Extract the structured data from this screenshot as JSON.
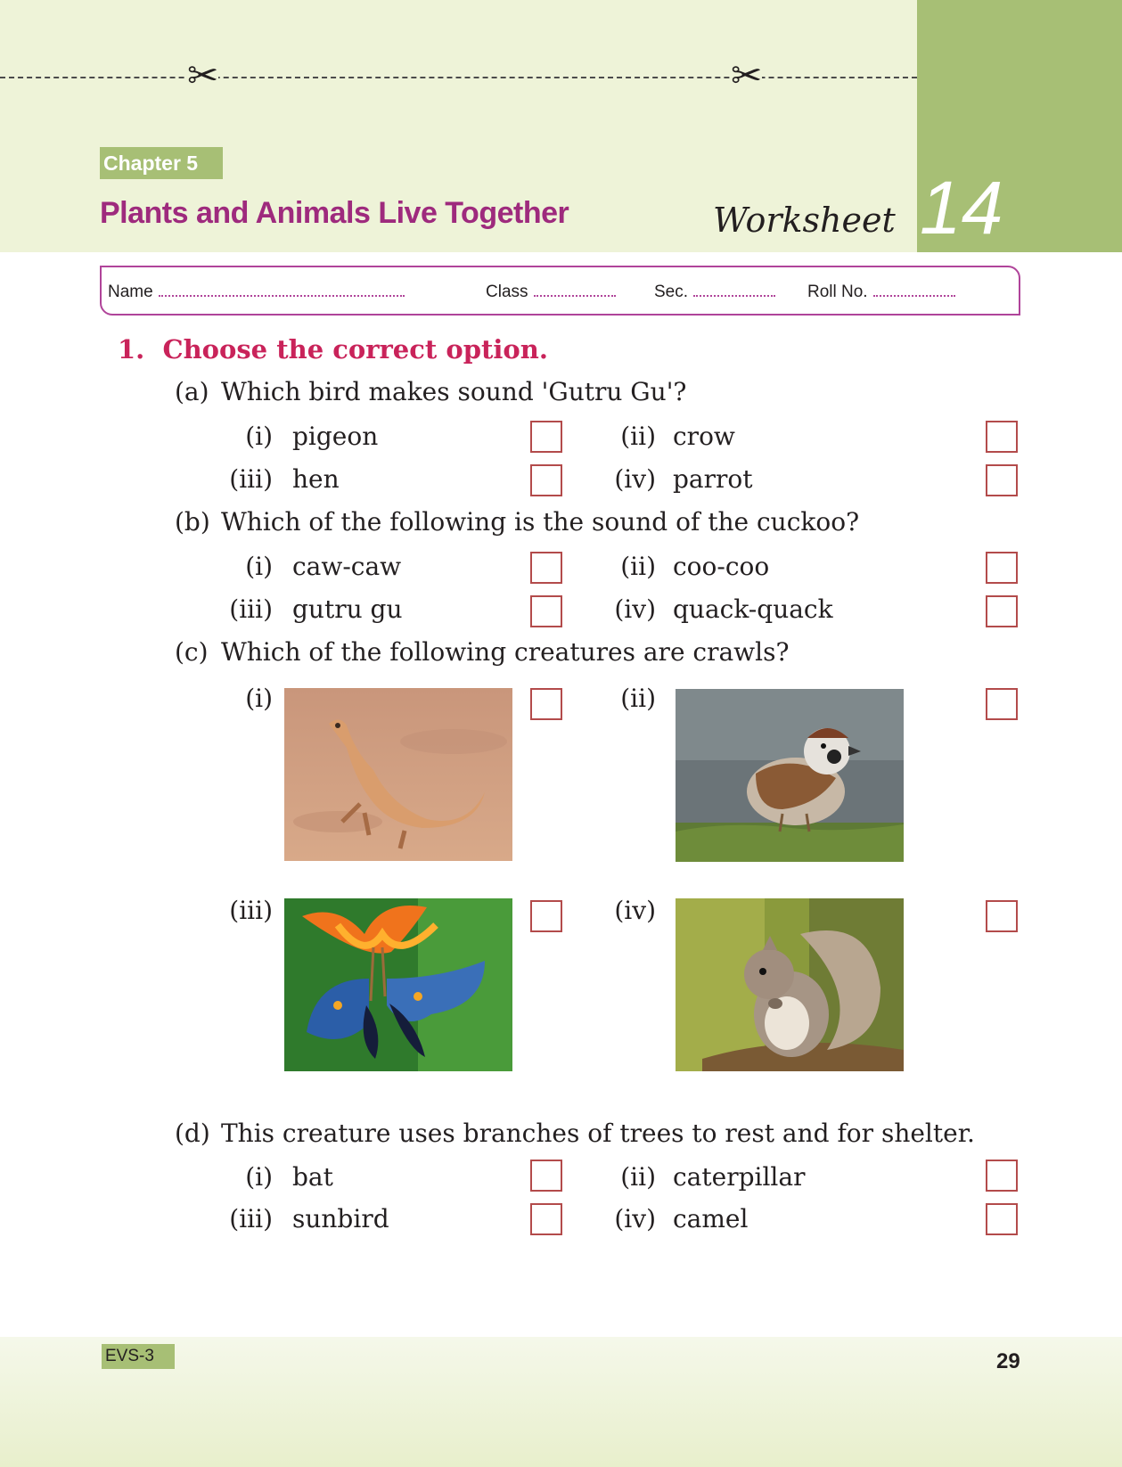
{
  "header": {
    "chapter": "Chapter 5",
    "title": "Plants and Animals Live Together",
    "worksheet_word": "Worksheet",
    "worksheet_number": "14"
  },
  "name_fields": {
    "name": "Name",
    "class": "Class",
    "sec": "Sec.",
    "roll": "Roll No."
  },
  "section": {
    "number": "1.",
    "heading": "Choose the correct option."
  },
  "questions": {
    "a": {
      "label": "(a)",
      "text": "Which bird makes sound 'Gutru Gu'?",
      "options": [
        {
          "num": "(i)",
          "text": "pigeon"
        },
        {
          "num": "(ii)",
          "text": "crow"
        },
        {
          "num": "(iii)",
          "text": "hen"
        },
        {
          "num": "(iv)",
          "text": "parrot"
        }
      ]
    },
    "b": {
      "label": "(b)",
      "text": "Which of the following is the sound of the cuckoo?",
      "options": [
        {
          "num": "(i)",
          "text": "caw-caw"
        },
        {
          "num": "(ii)",
          "text": "coo-coo"
        },
        {
          "num": "(iii)",
          "text": "gutru gu"
        },
        {
          "num": "(iv)",
          "text": "quack-quack"
        }
      ]
    },
    "c": {
      "label": "(c)",
      "text": "Which of the following creatures are crawls?",
      "options": [
        {
          "num": "(i)",
          "image": "lizard"
        },
        {
          "num": "(ii)",
          "image": "sparrow"
        },
        {
          "num": "(iii)",
          "image": "butterflies-on-lily"
        },
        {
          "num": "(iv)",
          "image": "squirrel"
        }
      ]
    },
    "d": {
      "label": "(d)",
      "text": "This creature uses branches of trees to rest and for shelter.",
      "options": [
        {
          "num": "(i)",
          "text": "bat"
        },
        {
          "num": "(ii)",
          "text": "caterpillar"
        },
        {
          "num": "(iii)",
          "text": "sunbird"
        },
        {
          "num": "(iv)",
          "text": "camel"
        }
      ]
    }
  },
  "footer": {
    "book": "EVS-3",
    "page": "29"
  },
  "colors": {
    "band": "#eef3d8",
    "tab": "#a7bf75",
    "title": "#9e2a7d",
    "heading": "#c9235a",
    "checkbox_border": "#b34b4b"
  }
}
